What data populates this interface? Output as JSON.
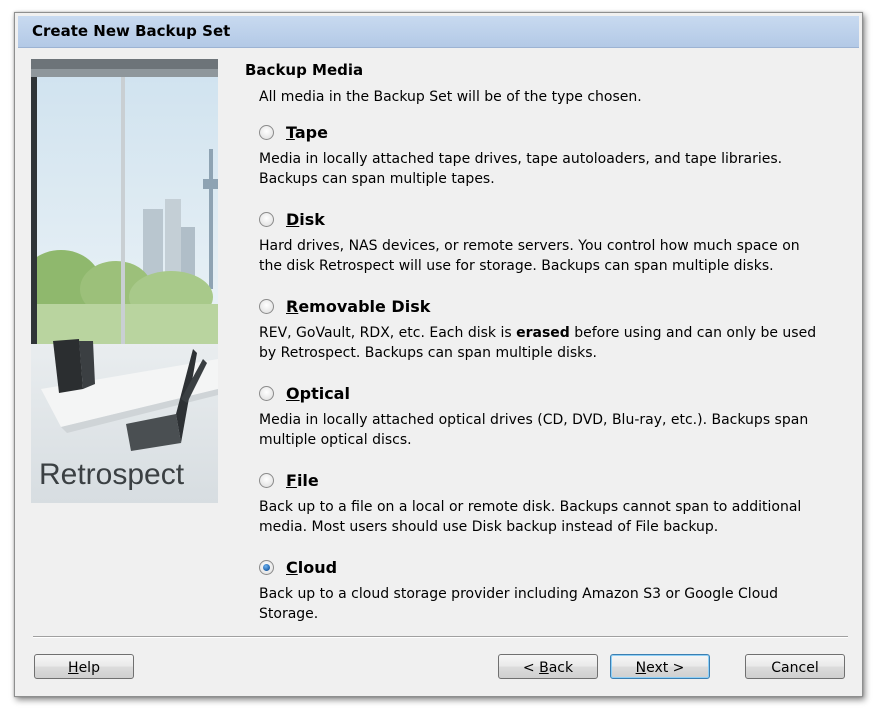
{
  "window": {
    "title": "Create New Backup Set"
  },
  "brand": {
    "logo_text": "Retrospect"
  },
  "section": {
    "title": "Backup Media",
    "subtitle": "All media in the Backup Set will be of the type chosen."
  },
  "options": [
    {
      "key": "tape",
      "access_key": "T",
      "label_rest": "ape",
      "selected": false,
      "description_1": "Media in locally attached tape drives, tape autoloaders, and tape libraries.",
      "description_2": "Backups can span multiple tapes."
    },
    {
      "key": "disk",
      "access_key": "D",
      "label_rest": "isk",
      "selected": false,
      "description_1": "Hard drives, NAS devices, or remote servers. You control how much space on",
      "description_2": "the disk Retrospect will use for storage. Backups can span multiple disks."
    },
    {
      "key": "removable",
      "access_key": "R",
      "label_rest": "emovable Disk",
      "selected": false,
      "description_1a": "REV, GoVault, RDX, etc. Each disk is ",
      "description_1b": "erased",
      "description_1c": " before using and can only be used",
      "description_2": "by Retrospect. Backups can span multiple disks."
    },
    {
      "key": "optical",
      "access_key": "O",
      "label_rest": "ptical",
      "selected": false,
      "description_1": "Media in locally attached optical drives (CD, DVD, Blu-ray, etc.). Backups span",
      "description_2": "multiple optical discs."
    },
    {
      "key": "file",
      "access_key": "F",
      "label_rest": "ile",
      "selected": false,
      "description_1": "Back up to a file on a local or remote disk. Backups cannot span to additional",
      "description_2": "media. Most users should use Disk backup instead of File backup."
    },
    {
      "key": "cloud",
      "access_key": "C",
      "label_rest": "loud",
      "selected": true,
      "description_1": "Back up to a cloud storage provider including Amazon S3 or Google Cloud",
      "description_2": "Storage."
    }
  ],
  "buttons": {
    "help": {
      "access_key": "H",
      "rest": "elp"
    },
    "back": {
      "prefix": "< ",
      "access_key": "B",
      "rest": "ack"
    },
    "next": {
      "access_key": "N",
      "rest": "ext >"
    },
    "cancel": {
      "label": "Cancel"
    }
  }
}
